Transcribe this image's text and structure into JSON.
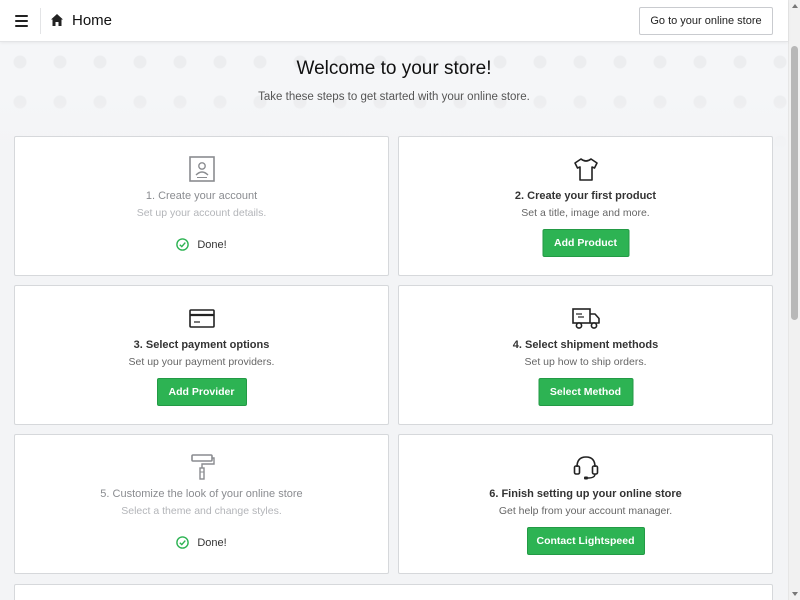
{
  "header": {
    "title": "Home",
    "store_button": "Go to your online store"
  },
  "hero": {
    "welcome": "Welcome to your store!",
    "subtitle": "Take these steps to get started with your online store."
  },
  "steps": [
    {
      "title": "1. Create your account",
      "desc": "Set up your account details.",
      "status": "Done!",
      "completed": true,
      "icon": "account-card-icon"
    },
    {
      "title": "2. Create your first product",
      "desc": "Set a title, image and more.",
      "button": "Add Product",
      "completed": false,
      "icon": "tshirt-icon"
    },
    {
      "title": "3. Select payment options",
      "desc": "Set up your payment providers.",
      "button": "Add Provider",
      "completed": false,
      "icon": "credit-card-icon"
    },
    {
      "title": "4. Select shipment methods",
      "desc": "Set up how to ship orders.",
      "button": "Select Method",
      "completed": false,
      "icon": "truck-icon"
    },
    {
      "title": "5. Customize the look of your online store",
      "desc": "Select a theme and change styles.",
      "status": "Done!",
      "completed": true,
      "icon": "paint-roller-icon"
    },
    {
      "title": "6. Finish setting up your online store",
      "desc": "Get help from your account manager.",
      "button": "Contact Lightspeed",
      "completed": false,
      "icon": "headset-icon"
    }
  ],
  "colors": {
    "accent_green": "#2db353",
    "done_check": "#2db353"
  }
}
